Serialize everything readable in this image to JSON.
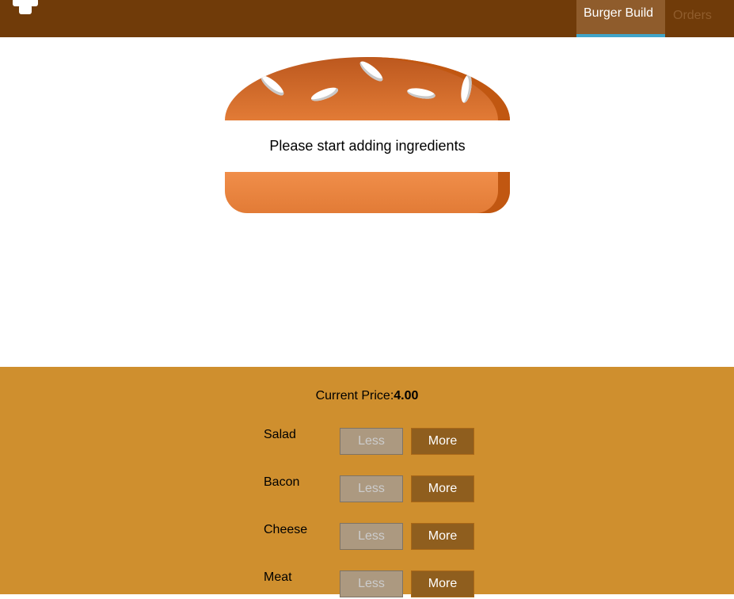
{
  "colors": {
    "toolbar": "#703B09",
    "nav_active": "#8F5C2C",
    "nav_active_underline": "#40A4C8",
    "controls_bg": "#CF8F2E",
    "less_bg": "#AC9980",
    "more_bg": "#8F5E1E"
  },
  "nav": {
    "items": [
      {
        "label": "Burger Build",
        "active": true
      },
      {
        "label": "Orders",
        "active": false
      }
    ]
  },
  "burger": {
    "message": "Please start adding ingredients"
  },
  "controls": {
    "price_label": "Current Price:",
    "price_value": "4.00",
    "ingredients": [
      {
        "label": "Salad",
        "less": "Less",
        "more": "More"
      },
      {
        "label": "Bacon",
        "less": "Less",
        "more": "More"
      },
      {
        "label": "Cheese",
        "less": "Less",
        "more": "More"
      },
      {
        "label": "Meat",
        "less": "Less",
        "more": "More"
      }
    ]
  }
}
